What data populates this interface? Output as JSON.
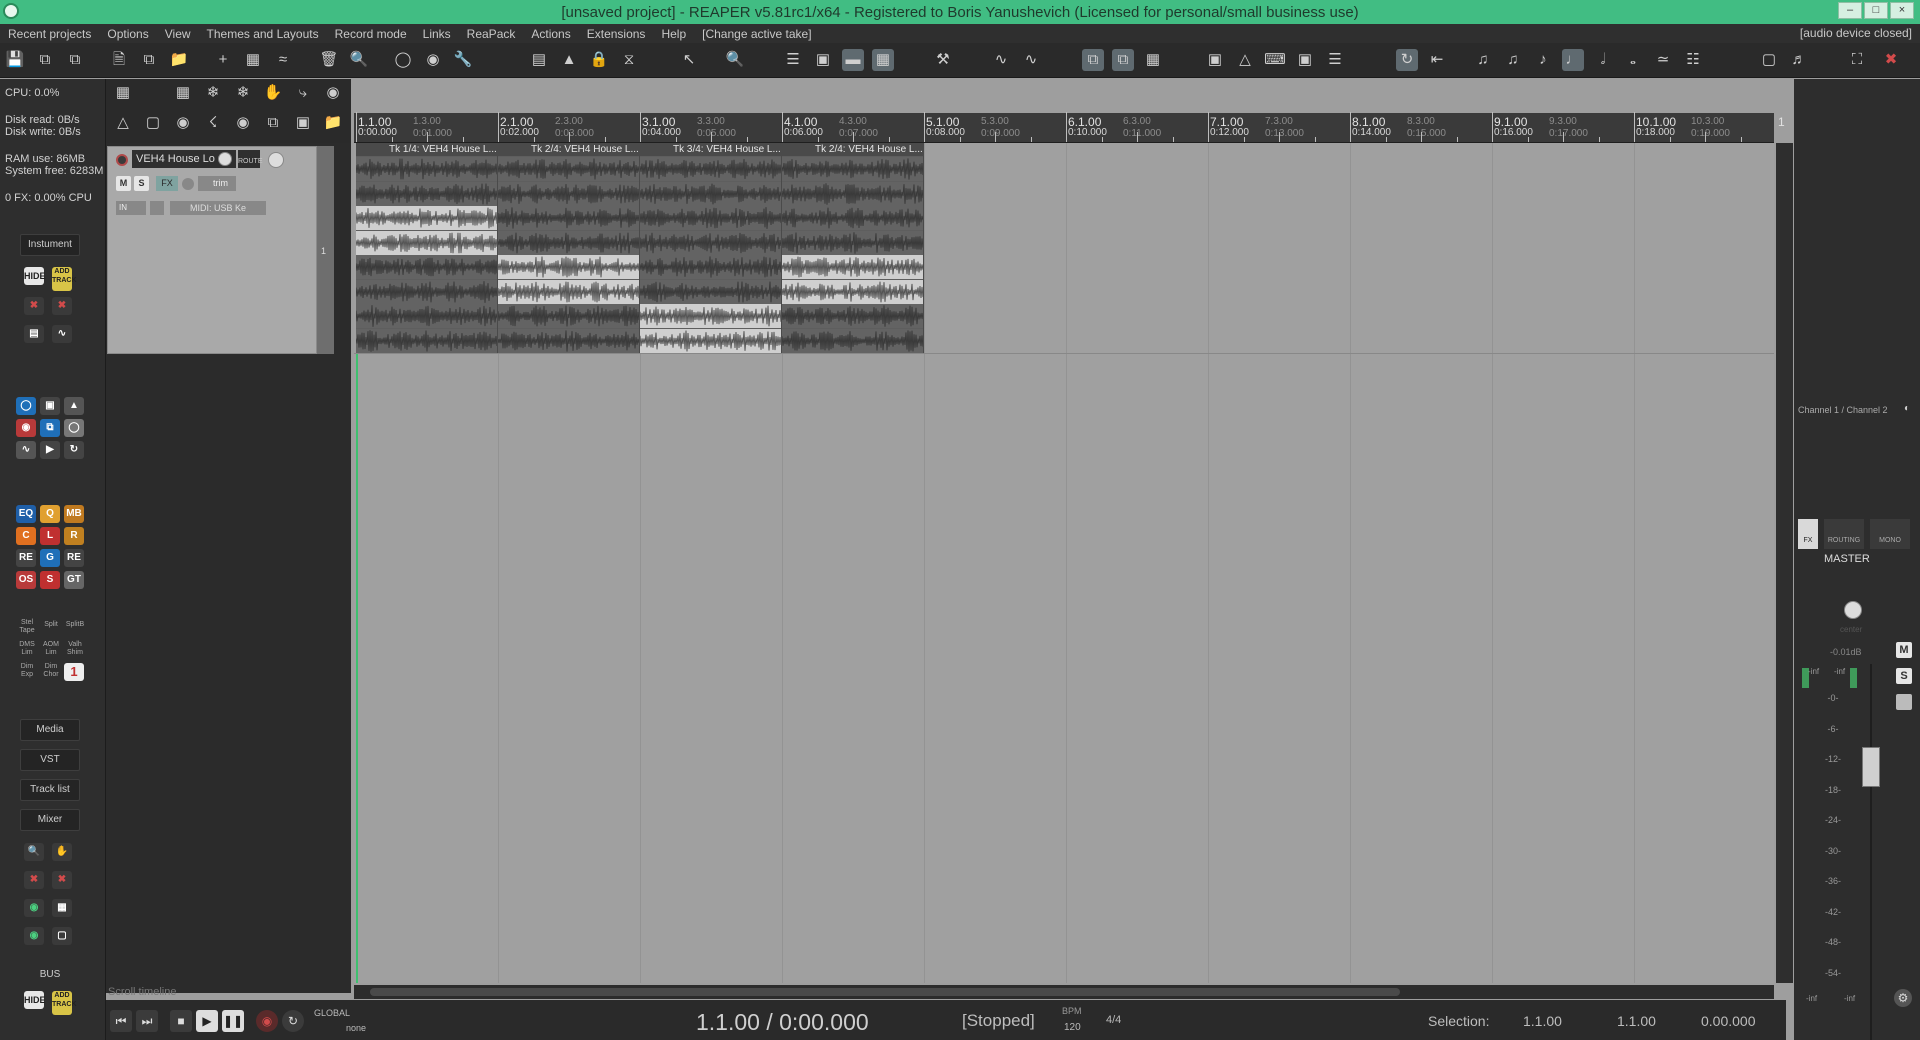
{
  "window": {
    "title": "[unsaved project] - REAPER v5.81rc1/x64 - Registered to Boris Yanushevich (Licensed for personal/small business use)"
  },
  "menu": {
    "items": [
      "Recent projects",
      "Options",
      "View",
      "Themes and Layouts",
      "Record mode",
      "Links",
      "ReaPack",
      "Actions",
      "Extensions",
      "Help",
      "[Change active take]"
    ],
    "status": "[audio device closed]"
  },
  "perf": {
    "cpu": "CPU: 0.0%",
    "disk_read": "Disk read: 0B/s",
    "disk_write": "Disk write: 0B/s",
    "ram": "RAM use: 86MB",
    "sys_free": "System free: 6283M",
    "fx_cpu": "0 FX: 0.00% CPU"
  },
  "sidebar": {
    "instrument_label": "Instument",
    "hide": "HIDE",
    "add_track": "ADD TRACK",
    "nav": [
      "Media",
      "VST",
      "Track list",
      "Mixer"
    ],
    "bus": "BUS",
    "hide2": "HIDE",
    "add_track2": "ADD TRACK",
    "plugin_icons": [
      "EQ",
      "Q",
      "MB",
      "C",
      "L",
      "R",
      "RE",
      "G",
      "RE",
      "OS",
      "S",
      "GT"
    ],
    "plugin_caps": [
      "Stel Tape",
      "Split",
      "SplitB",
      "DMS Lim",
      "AOM Lim",
      "Valh Shim",
      "Dim Exp",
      "Dim Chor"
    ]
  },
  "track": {
    "name": "VEH4 House Lo",
    "route": "ROUTE",
    "mute": "M",
    "solo": "S",
    "fx": "FX",
    "trim": "trim",
    "input": "IN",
    "midi": "MIDI: USB Ke",
    "number": "1"
  },
  "ruler": {
    "bars": [
      {
        "label": "1.1.00",
        "time": "0:00.000"
      },
      {
        "label": "2.1.00",
        "time": "0:02.000"
      },
      {
        "label": "3.1.00",
        "time": "0:04.000"
      },
      {
        "label": "4.1.00",
        "time": "0:06.000"
      },
      {
        "label": "5.1.00",
        "time": "0:08.000"
      },
      {
        "label": "6.1.00",
        "time": "0:10.000"
      },
      {
        "label": "7.1.00",
        "time": "0:12.000"
      },
      {
        "label": "8.1.00",
        "time": "0:14.000"
      },
      {
        "label": "9.1.00",
        "time": "0:16.000"
      },
      {
        "label": "10.1.00",
        "time": "0:18.000"
      }
    ],
    "subs": [
      {
        "label": "1.3.00",
        "time": "0:01.000"
      },
      {
        "label": "2.3.00",
        "time": "0:03.000"
      },
      {
        "label": "3.3.00",
        "time": "0:05.000"
      },
      {
        "label": "4.3.00",
        "time": "0:07.000"
      },
      {
        "label": "5.3.00",
        "time": "0:09.000"
      },
      {
        "label": "6.3.00",
        "time": "0:11.000"
      },
      {
        "label": "7.3.00",
        "time": "0:13.000"
      },
      {
        "label": "8.3.00",
        "time": "0:15.000"
      },
      {
        "label": "9.3.00",
        "time": "0:17.000"
      },
      {
        "label": "10.3.00",
        "time": "0:19.000"
      }
    ],
    "edge": "1"
  },
  "items": [
    {
      "label": "Tk 1/4: VEH4 House L...",
      "selected_lane": 1
    },
    {
      "label": "Tk 2/4: VEH4 House L...",
      "selected_lane": 2
    },
    {
      "label": "Tk 3/4: VEH4 House L...",
      "selected_lane": 3
    },
    {
      "label": "Tk 2/4: VEH4 House L...",
      "selected_lane": 2
    }
  ],
  "transport": {
    "position": "1.1.00 / 0:00.000",
    "state": "[Stopped]",
    "bpm_label": "BPM",
    "bpm": "120",
    "timesig": "4/4",
    "global": "GLOBAL",
    "none": "none",
    "selection_label": "Selection:",
    "sel_start": "1.1.00",
    "sel_end": "1.1.00",
    "sel_len": "0.00.000",
    "scroll_timeline": "Scroll timeline"
  },
  "mixer": {
    "channel": "Channel 1 / Channel 2",
    "fx": "FX",
    "routing": "ROUTING",
    "mono": "MONO",
    "name": "MASTER",
    "center": "center",
    "volume": "-0.01dB",
    "peak_l": "-inf",
    "peak_r": "-inf",
    "mute": "M",
    "solo": "S",
    "scale": [
      "-0-",
      "-6-",
      "-12-",
      "-18-",
      "-24-",
      "-30-",
      "-36-",
      "-42-",
      "-48-",
      "-54-"
    ],
    "bottom_l": "-inf",
    "bottom_r": "-inf"
  },
  "colors": {
    "titlebar": "#41bd83",
    "arrange": "#a0a0a0",
    "selected_lane": "#cfcfcf",
    "item": "#5e5e5e",
    "panel": "#2d2d2d"
  }
}
